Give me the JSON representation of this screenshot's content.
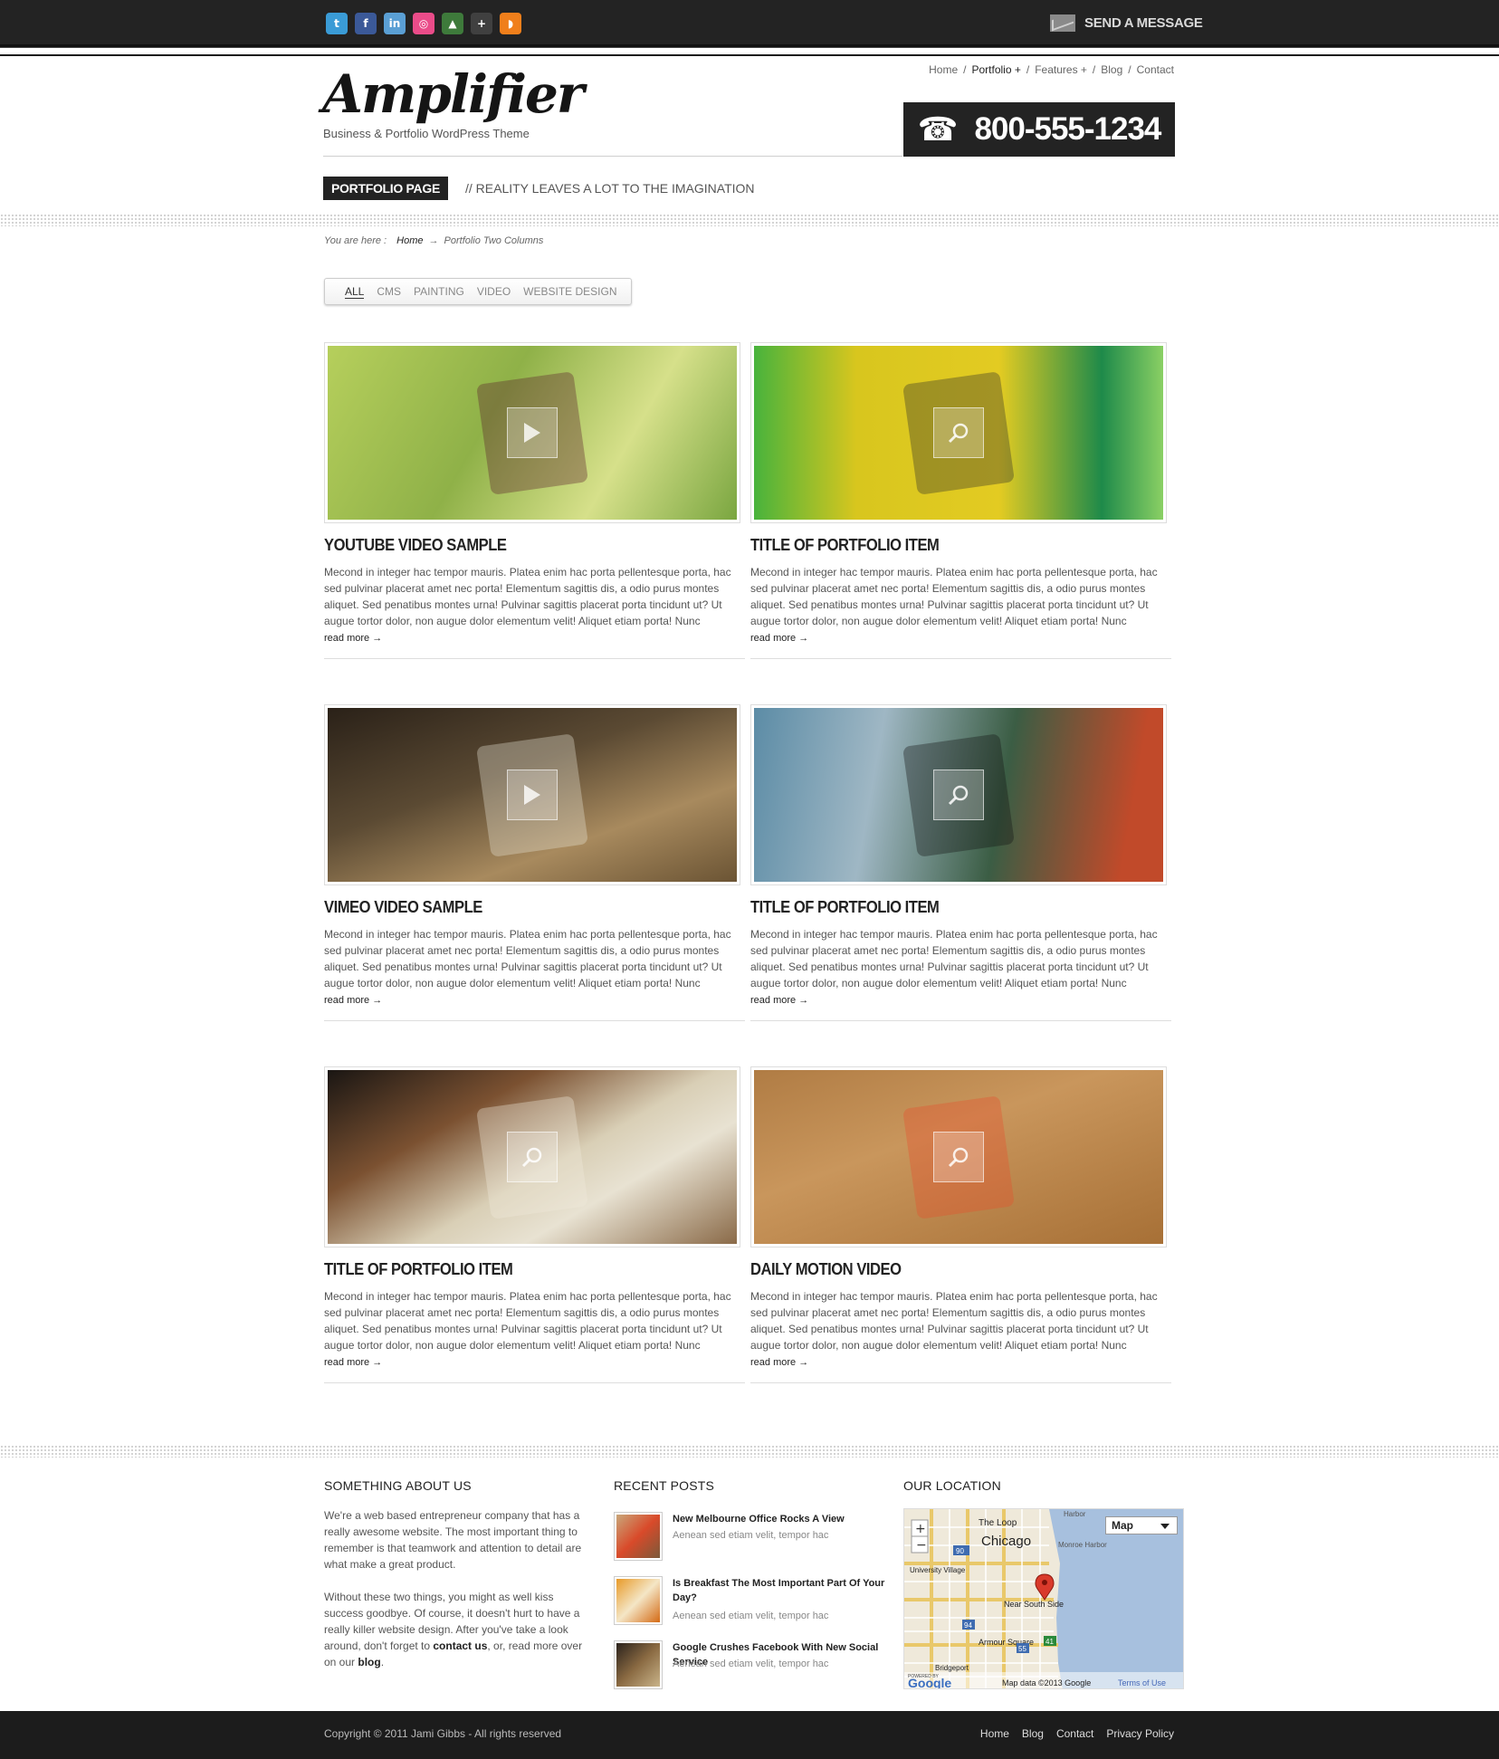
{
  "topbar": {
    "social": [
      {
        "icon": "twitter-icon",
        "glyph": "t",
        "color": "#3a9bd6"
      },
      {
        "icon": "facebook-icon",
        "glyph": "f",
        "color": "#3b5998"
      },
      {
        "icon": "linkedin-icon",
        "glyph": "in",
        "color": "#5a9fd4"
      },
      {
        "icon": "dribbble-icon",
        "glyph": "◎",
        "color": "#ea4c89"
      },
      {
        "icon": "forrst-icon",
        "glyph": "▲",
        "color": "#3e7a3b"
      },
      {
        "icon": "googleplus-icon",
        "glyph": "+",
        "color": "#404040"
      },
      {
        "icon": "rss-icon",
        "glyph": "◗",
        "color": "#f07f1b"
      }
    ],
    "send_message": "Send a Message"
  },
  "header": {
    "logo": "Amplifier",
    "tagline": "Business & Portfolio WordPress Theme",
    "phone": "800-555-1234",
    "nav": [
      {
        "label": "Home",
        "current": false
      },
      {
        "label": "Portfolio +",
        "current": true
      },
      {
        "label": "Features +",
        "current": false
      },
      {
        "label": "Blog",
        "current": false
      },
      {
        "label": "Contact",
        "current": false
      }
    ],
    "nav_sep": "/"
  },
  "page": {
    "badge": "PORTFOLIO PAGE",
    "slogan": "// REALITY LEAVES A LOT TO THE IMAGINATION",
    "breadcrumb": {
      "prefix": "You are here :",
      "home": "Home",
      "arrow": "→",
      "current": "Portfolio Two Columns"
    }
  },
  "filters": [
    "ALL",
    "CMS",
    "PAINTING",
    "VIDEO",
    "WEBSITE DESIGN"
  ],
  "items_text": "Mecond in integer hac tempor mauris. Platea enim hac porta pellentesque porta, hac sed pulvinar placerat amet nec porta! Elementum sagittis dis, a odio purus montes aliquet. Sed penatibus montes urna! Pulvinar sagittis placerat porta tincidunt ut? Ut augue tortor dolor, non augue dolor elementum velit! Aliquet etiam porta! Nunc",
  "read_more": "read more →",
  "items": [
    {
      "title": "YOUTUBE VIDEO SAMPLE",
      "overlay": "play-icon",
      "bg": "linear-gradient(120deg,#b6cf5c,#8fb148 40%,#d6e08a 70%,#7aa640)",
      "accent": "#5a1a2a"
    },
    {
      "title": "TITLE OF PORTFOLIO ITEM",
      "overlay": "zoom-icon",
      "bg": "linear-gradient(90deg,#48b33c,#d8c61e 25%,#e3cb22 60%,#1e8a4a 85%,#8ad064)",
      "accent": "#2a2a2a"
    },
    {
      "title": "VIMEO VIDEO SAMPLE",
      "overlay": "play-icon",
      "bg": "linear-gradient(160deg,#2a2118,#5b4a33 40%,#a88a5e 70%,#6b5434)",
      "accent": "#e8e4d8"
    },
    {
      "title": "TITLE OF PORTFOLIO ITEM",
      "overlay": "zoom-icon",
      "bg": "linear-gradient(100deg,#5c8ca6,#9fb7c4 30%,#3b5d44 60%,#c14a2a 90%)",
      "accent": "#111"
    },
    {
      "title": "TITLE OF PORTFOLIO ITEM",
      "overlay": "zoom-icon",
      "bg": "linear-gradient(150deg,#1a1613,#7b5131 30%,#d9cfb6 55%,#e8e2d2 70%,#8a6a48)",
      "accent": "#f2ecdc"
    },
    {
      "title": "DAILY MOTION VIDEO",
      "overlay": "zoom-icon",
      "bg": "linear-gradient(160deg,#b07c44,#c9965c 40%,#a77036)",
      "accent": "#e84d2a"
    }
  ],
  "footer": {
    "about_title": "SOMETHING ABOUT US",
    "about_p1": "We're a web based entrepreneur company that has a really awesome website. The most important thing to remember is that teamwork and attention to detail are what make a great product.",
    "about_p2_a": "Without these two things, you might as well kiss success goodbye. Of course, it doesn't hurt to have a really killer website design. After you've take a look around, don't forget to ",
    "about_contact": "contact us",
    "about_p2_b": ", or, read more over on our ",
    "about_blog": "blog",
    "about_p2_c": ".",
    "posts_title": "RECENT POSTS",
    "posts": [
      {
        "title": "New Melbourne Office Rocks A View",
        "excerpt": "Aenean sed etiam velit, tempor hac"
      },
      {
        "title": "Is Breakfast The Most Important Part Of Your Day?",
        "excerpt": "Aenean sed etiam velit, tempor hac"
      },
      {
        "title": "Google Crushes Facebook With New Social Service",
        "excerpt": "Aenean sed etiam velit, tempor hac"
      }
    ],
    "location_title": "OUR LOCATION",
    "map": {
      "type_select": "Map",
      "labels": [
        "The Loop",
        "Chicago",
        "University Village",
        "Near South Side",
        "Armour Square",
        "Bridgeport",
        "Monroe Harbor",
        "Harbor"
      ],
      "highways": [
        "90",
        "94",
        "41",
        "55"
      ],
      "copyright": "Map data ©2013 Google",
      "terms": "Terms of Use",
      "brand": "Google",
      "powered": "POWERED BY"
    },
    "copyright": "Copyright © 2011 Jami Gibbs - All rights reserved",
    "links": [
      "Home",
      "Blog",
      "Contact",
      "Privacy Policy"
    ]
  }
}
